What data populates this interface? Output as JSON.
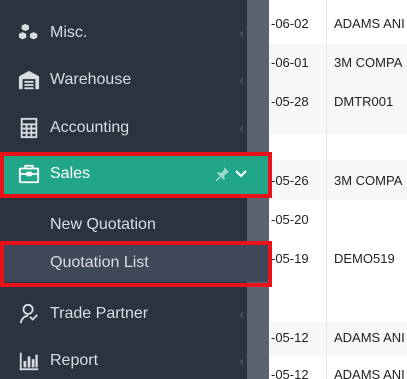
{
  "sidebar": {
    "items": [
      {
        "label": "Misc.",
        "icon": "cubes-icon"
      },
      {
        "label": "Warehouse",
        "icon": "warehouse-icon"
      },
      {
        "label": "Accounting",
        "icon": "calculator-icon"
      },
      {
        "label": "Sales",
        "icon": "briefcase-icon"
      },
      {
        "label": "Trade Partner",
        "icon": "handshake-icon"
      },
      {
        "label": "Report",
        "icon": "bar-chart-icon"
      }
    ],
    "sales_submenu": [
      {
        "label": "New Quotation"
      },
      {
        "label": "Quotation List"
      }
    ],
    "active_item": "Sales",
    "selected_subitem": "Quotation List"
  },
  "table": {
    "rows": [
      {
        "date": "-06-02",
        "name": "ADAMS ANI"
      },
      {
        "date": "-06-01",
        "name": "3M COMPA"
      },
      {
        "date": "-05-28",
        "name": "DMTR001"
      },
      {
        "date": "-05-26",
        "name": "3M COMPA"
      },
      {
        "date": "-05-20",
        "name": ""
      },
      {
        "date": "-05-19",
        "name": "DEMO519"
      },
      {
        "date": "-05-12",
        "name": "ADAMS ANI"
      },
      {
        "date": "-05-12",
        "name": "ADAMS ANI"
      }
    ]
  },
  "colors": {
    "sidebar_bg": "#2b3340",
    "active_bg": "#22a68a",
    "highlight": "#e8121b"
  }
}
